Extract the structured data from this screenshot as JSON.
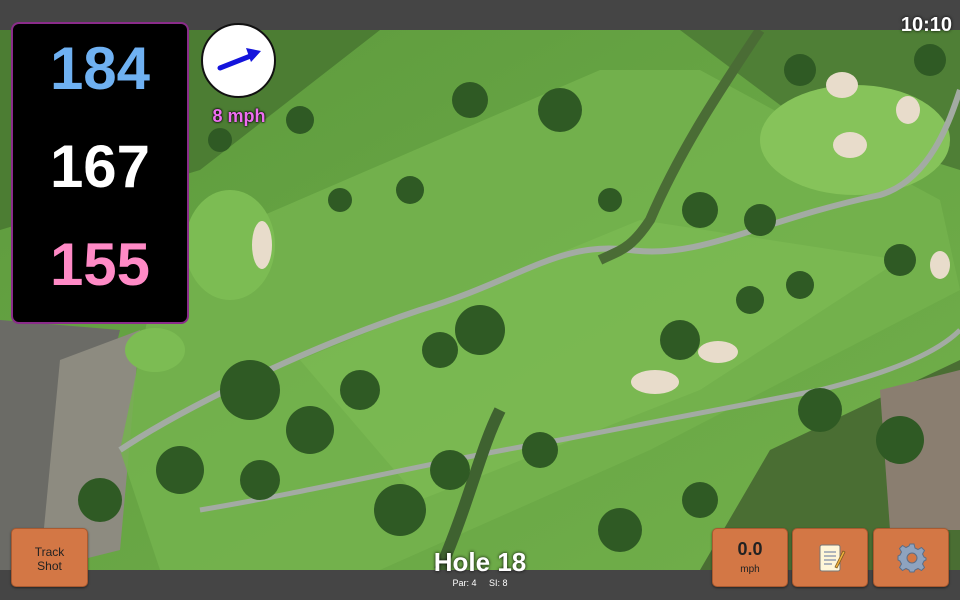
{
  "clock": "10:10",
  "distances": {
    "front": "184",
    "center": "167",
    "back": "155"
  },
  "wind": {
    "speed_label": "8 mph",
    "direction_icon": "wind-arrow-icon"
  },
  "track_shot_label": "Track Shot",
  "wind_readout": {
    "value": "0.0",
    "unit": "mph"
  },
  "notes_icon": "notepad-icon",
  "settings_icon": "gear-icon",
  "hole": {
    "title": "Hole 18",
    "par": "Par: 4",
    "si": "SI: 8"
  },
  "colors": {
    "front_distance": "#6fb1f2",
    "center_distance": "#ffffff",
    "back_distance": "#ff8ac6",
    "wind_text": "#ee6ef0",
    "button": "#d37745",
    "arrow": "#1414dc",
    "fairway": "#6fae48",
    "green": "#86c35a",
    "bunker": "#e8dccb",
    "path": "#9aa39a",
    "trees": "#2f5a24"
  }
}
